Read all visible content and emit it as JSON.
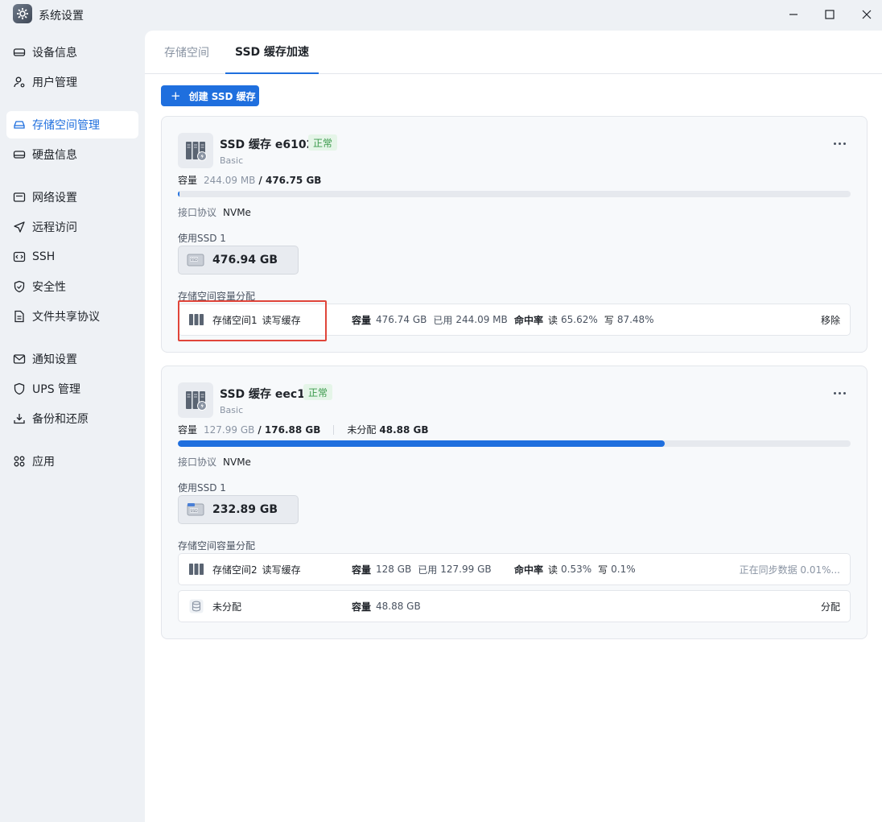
{
  "window": {
    "title": "系统设置"
  },
  "sidebar": {
    "items": [
      {
        "label": "设备信息",
        "icon": "device-icon"
      },
      {
        "label": "用户管理",
        "icon": "user-icon"
      },
      {
        "label": "存储空间管理",
        "icon": "storage-icon",
        "active": true
      },
      {
        "label": "硬盘信息",
        "icon": "disk-icon"
      },
      {
        "label": "网络设置",
        "icon": "network-icon"
      },
      {
        "label": "远程访问",
        "icon": "send-icon"
      },
      {
        "label": "SSH",
        "icon": "code-icon"
      },
      {
        "label": "安全性",
        "icon": "shield-icon"
      },
      {
        "label": "文件共享协议",
        "icon": "file-icon"
      },
      {
        "label": "通知设置",
        "icon": "mail-icon"
      },
      {
        "label": "UPS 管理",
        "icon": "shield-outline-icon"
      },
      {
        "label": "备份和还原",
        "icon": "download-icon"
      },
      {
        "label": "应用",
        "icon": "apps-icon"
      }
    ]
  },
  "tabs": {
    "storage": "存储空间",
    "ssd_cache": "SSD 缓存加速"
  },
  "toolbar": {
    "create_label": "创建 SSD 缓存"
  },
  "cache1": {
    "title": "SSD 缓存 e6102",
    "status": "正常",
    "type": "Basic",
    "capacity_label": "容量",
    "used": "244.09 MB",
    "total": "/ 476.75 GB",
    "usage_fraction": 0.0005,
    "protocol_label": "接口协议",
    "protocol": "NVMe",
    "ssd_label": "使用SSD 1",
    "ssd_size": "476.94 GB",
    "alloc_label": "存储空间容量分配",
    "rows": [
      {
        "name": "存储空间1",
        "mode": "读写缓存",
        "cap_label": "容量",
        "cap": "476.74 GB",
        "used_label": "已用",
        "used": "244.09 MB",
        "hit_label": "命中率",
        "read_label": "读",
        "read": "65.62%",
        "write_label": "写",
        "write": "87.48%",
        "action": "移除"
      }
    ]
  },
  "cache2": {
    "title": "SSD 缓存 eec16",
    "status": "正常",
    "type": "Basic",
    "capacity_label": "容量",
    "used": "127.99 GB",
    "total": "/ 176.88 GB",
    "unalloc_label": "未分配",
    "unalloc": "48.88 GB",
    "usage_fraction": 0.724,
    "protocol_label": "接口协议",
    "protocol": "NVMe",
    "ssd_label": "使用SSD 1",
    "ssd_size": "232.89 GB",
    "alloc_label": "存储空间容量分配",
    "rows": [
      {
        "name": "存储空间2",
        "mode": "读写缓存",
        "cap_label": "容量",
        "cap": "128 GB",
        "used_label": "已用",
        "used": "127.99 GB",
        "hit_label": "命中率",
        "read_label": "读",
        "read": "0.53%",
        "write_label": "写",
        "write": "0.1%",
        "status": "正在同步数据 0.01%..."
      },
      {
        "name": "未分配",
        "cap_label": "容量",
        "cap": "48.88 GB",
        "action": "分配"
      }
    ]
  },
  "colors": {
    "accent": "#1f6fde",
    "ok": "#3a9a4b",
    "highlight": "#e0453a"
  }
}
